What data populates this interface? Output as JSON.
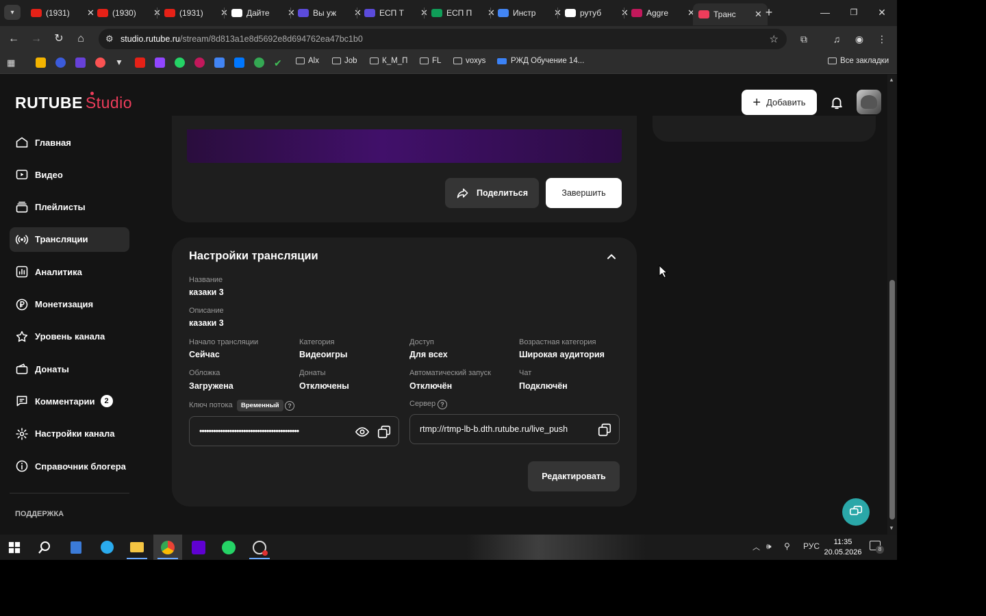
{
  "browser": {
    "tabs": [
      {
        "label": "(1931)",
        "color": "#e62117"
      },
      {
        "label": "(1930)",
        "color": "#e62117"
      },
      {
        "label": "(1931)",
        "color": "#e62117"
      },
      {
        "label": "Дайте",
        "color": "#ffffff"
      },
      {
        "label": "Вы уж",
        "color": "#5b4bdb"
      },
      {
        "label": "ЕСП Т",
        "color": "#5b4bdb"
      },
      {
        "label": "ЕСП П",
        "color": "#0f9d58"
      },
      {
        "label": "Инстр",
        "color": "#4285f4"
      },
      {
        "label": "рутуб",
        "color": "#ffffff"
      },
      {
        "label": "Aggre",
        "color": "#c2185b"
      },
      {
        "label": "Транс",
        "color": "#ee3d5b"
      }
    ],
    "url_host": "studio.rutube.ru",
    "url_path": "/stream/8d813a1e8d5692e8d694762ea47bc1b0",
    "bookmarks": [
      {
        "label": "Alx"
      },
      {
        "label": "Job"
      },
      {
        "label": "К_М_П"
      },
      {
        "label": "FL"
      },
      {
        "label": "voxys"
      },
      {
        "label": "РЖД Обучение 14..."
      }
    ],
    "all_bookmarks": "Все закладки"
  },
  "header": {
    "logo_main": "RUTUBE",
    "logo_sub": "Studio",
    "add_label": "Добавить",
    "accent": "#ee3d5b"
  },
  "sidebar": {
    "items": [
      {
        "label": "Главная",
        "icon": "home-icon"
      },
      {
        "label": "Видео",
        "icon": "video-icon"
      },
      {
        "label": "Плейлисты",
        "icon": "playlist-icon"
      },
      {
        "label": "Трансляции",
        "icon": "broadcast-icon"
      },
      {
        "label": "Аналитика",
        "icon": "analytics-icon"
      },
      {
        "label": "Монетизация",
        "icon": "ruble-icon"
      },
      {
        "label": "Уровень канала",
        "icon": "star-icon"
      },
      {
        "label": "Донаты",
        "icon": "wallet-icon"
      },
      {
        "label": "Комментарии",
        "icon": "comment-icon",
        "badge": "2"
      },
      {
        "label": "Настройки канала",
        "icon": "gear-icon"
      },
      {
        "label": "Справочник блогера",
        "icon": "info-icon"
      }
    ],
    "support_label": "ПОДДЕРЖКА"
  },
  "stream": {
    "share_label": "Поделиться",
    "finish_label": "Завершить"
  },
  "settings": {
    "title": "Настройки трансляции",
    "name_label": "Название",
    "name_value": "казаки 3",
    "desc_label": "Описание",
    "desc_value": "казаки 3",
    "start_label": "Начало трансляции",
    "start_value": "Сейчас",
    "category_label": "Категория",
    "category_value": "Видеоигры",
    "access_label": "Доступ",
    "access_value": "Для всех",
    "age_label": "Возрастная категория",
    "age_value": "Широкая аудитория",
    "cover_label": "Обложка",
    "cover_value": "Загружена",
    "donates_label": "Донаты",
    "donates_value": "Отключены",
    "autostart_label": "Автоматический запуск",
    "autostart_value": "Отключён",
    "chat_label": "Чат",
    "chat_value": "Подключён",
    "key_label": "Ключ потока",
    "key_badge": "Временный",
    "key_value": "•••••••••••••••••••••••••••••••••••••••••••",
    "server_label": "Сервер",
    "server_value": "rtmp://rtmp-lb-b.dth.rutube.ru/live_push",
    "edit_label": "Редактировать"
  },
  "taskbar": {
    "language": "РУС",
    "time": "11:35",
    "date": "20.05.2026",
    "notifications": "8"
  }
}
